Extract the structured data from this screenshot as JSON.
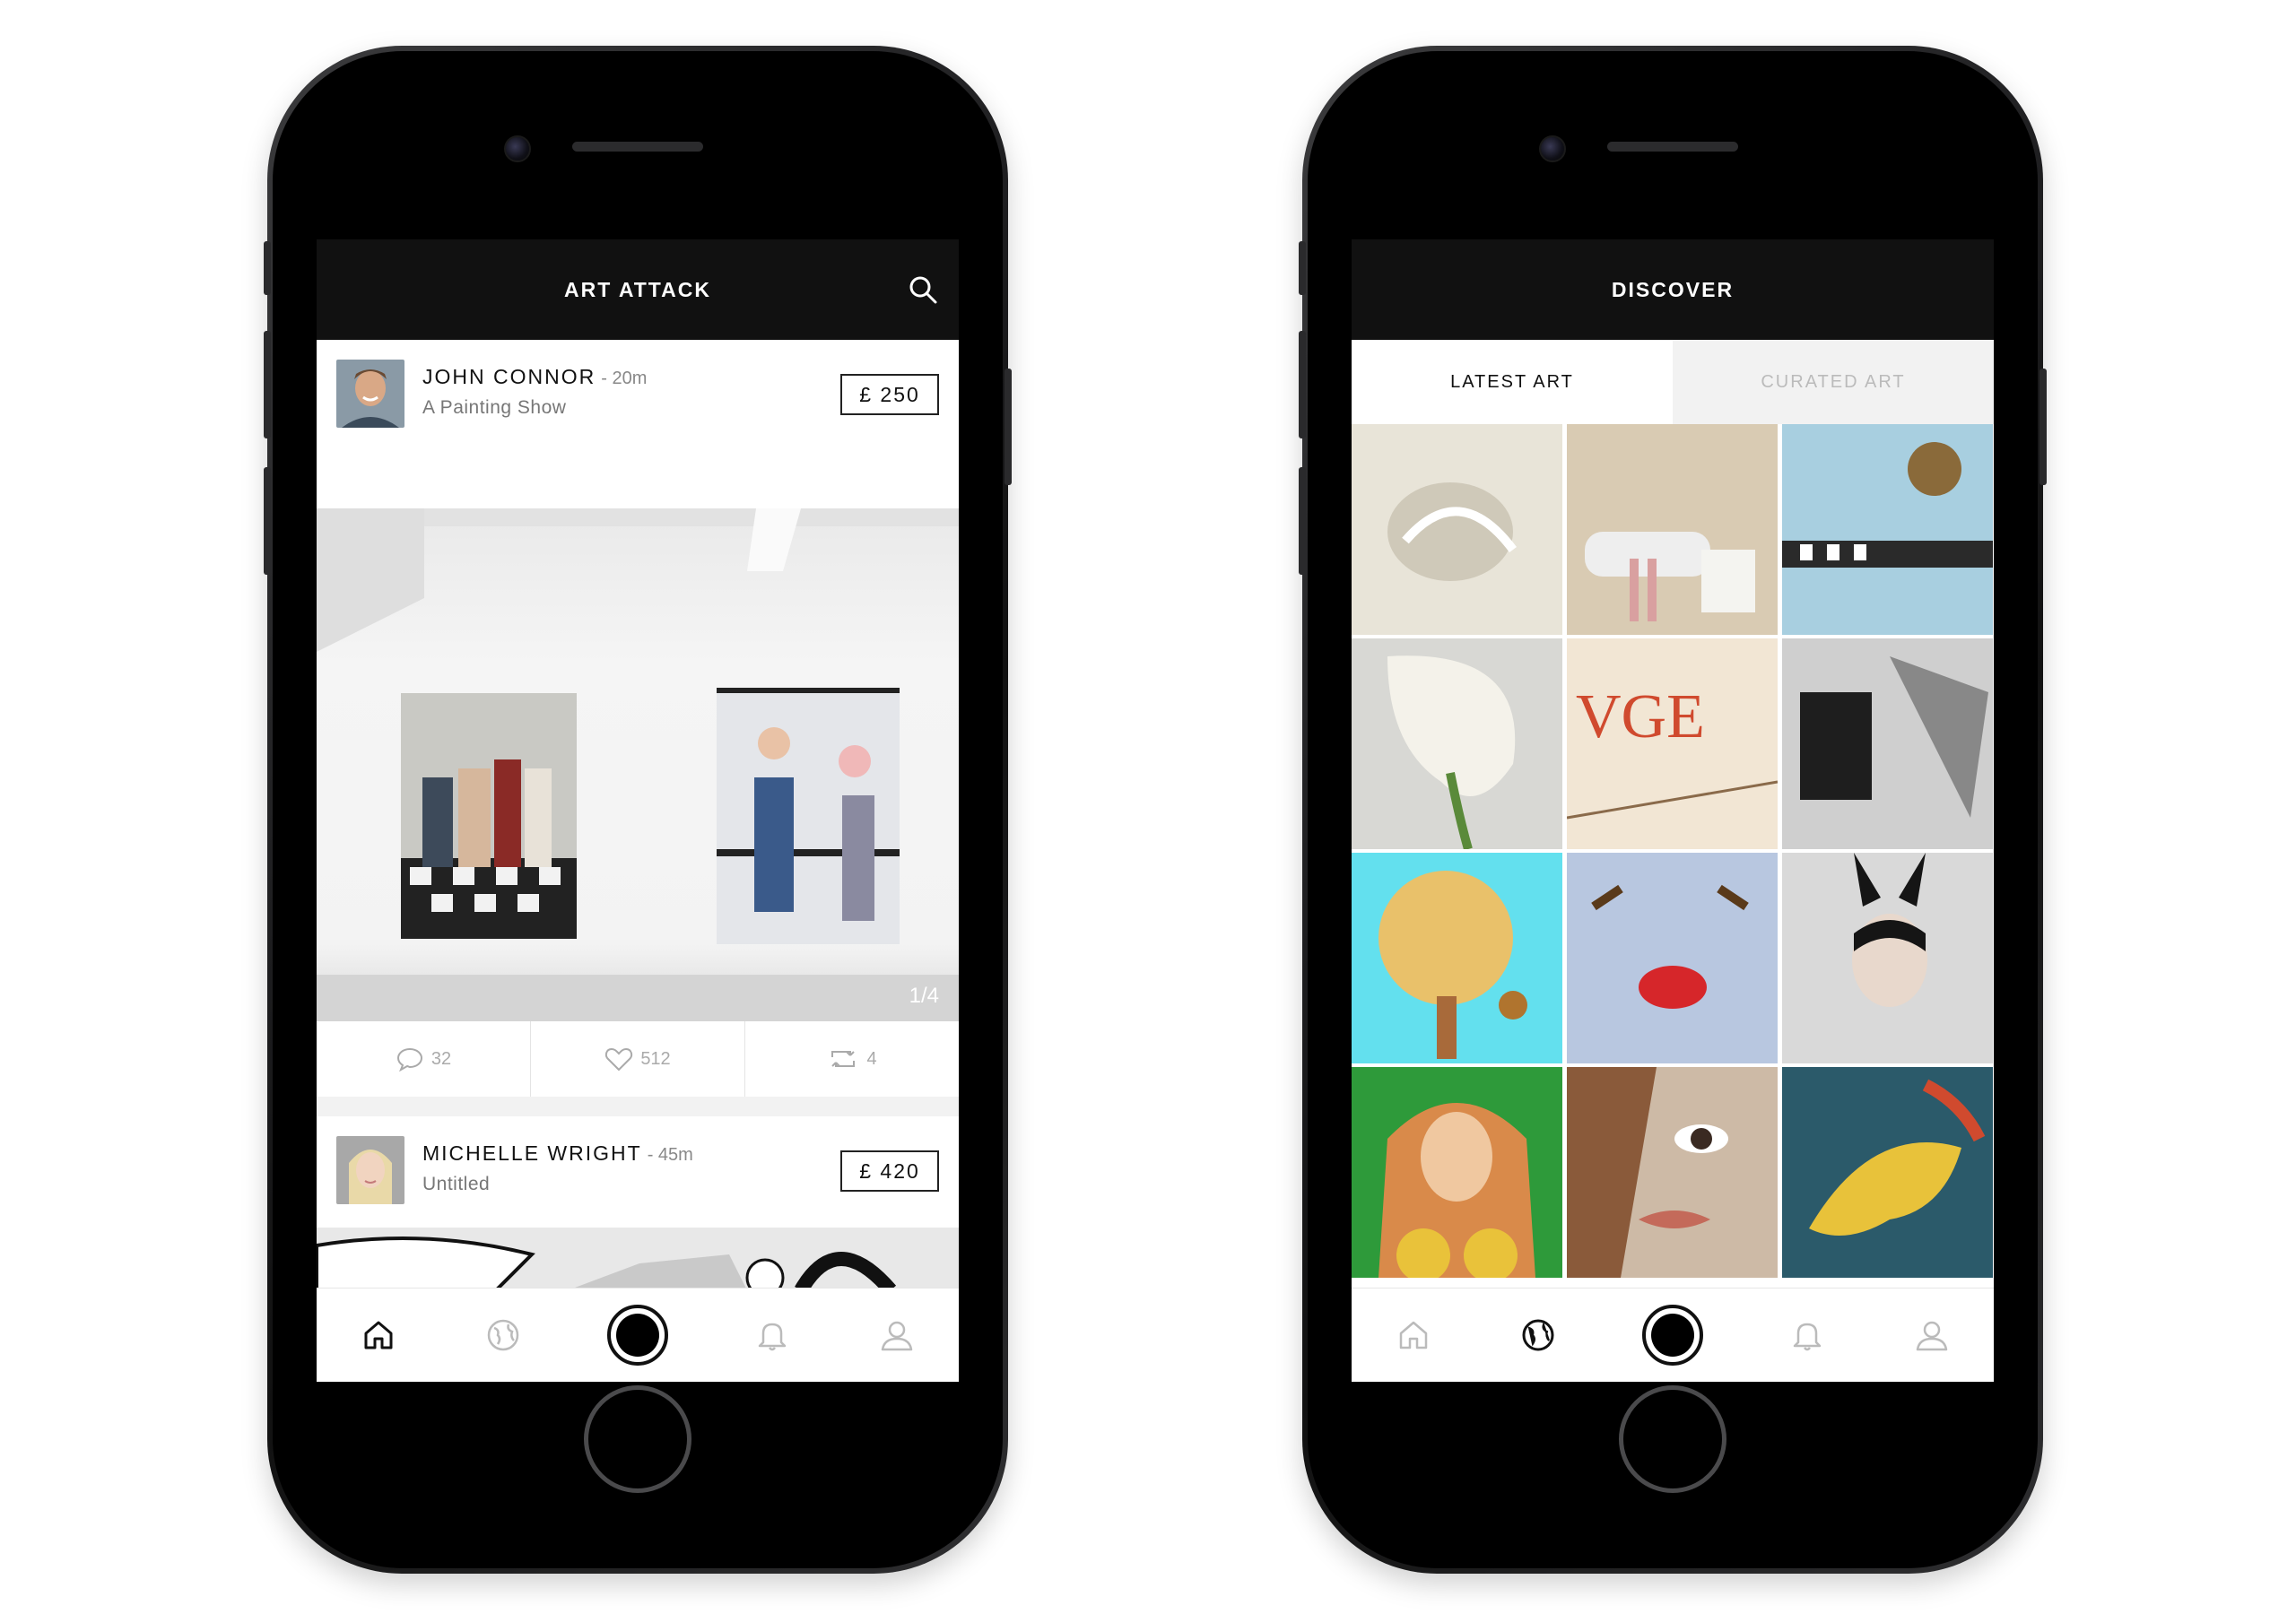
{
  "feed": {
    "title": "ART ATTACK",
    "posts": [
      {
        "user": "JOHN CONNOR",
        "time": "- 20m",
        "title": "A Painting Show",
        "price": "£ 250",
        "counter": "1/4",
        "comments": "32",
        "likes": "512",
        "reposts": "4"
      },
      {
        "user": "MICHELLE WRIGHT",
        "time": "- 45m",
        "title": "Untitled",
        "price": "£ 420"
      }
    ]
  },
  "discover": {
    "title": "DISCOVER",
    "tabs": {
      "latest": "LATEST ART",
      "curated": "CURATED ART"
    },
    "artworks": [
      {
        "name": "artwork-face-sculpture",
        "bg": "#e8e4d8",
        "accent": "#cfc9b9"
      },
      {
        "name": "artwork-bathroom",
        "bg": "#d9cbb3",
        "accent": "#a48b6a"
      },
      {
        "name": "artwork-keyboard",
        "bg": "#a8cfe0",
        "accent": "#2a2a2a"
      },
      {
        "name": "artwork-calla-lily",
        "bg": "#d8d8d4",
        "accent": "#f4f2ea"
      },
      {
        "name": "artwork-vogue",
        "bg": "#f2e6d4",
        "accent": "#d04a2e"
      },
      {
        "name": "artwork-abstract-bw",
        "bg": "#cfcfcf",
        "accent": "#1e1e1e"
      },
      {
        "name": "artwork-ping-pong",
        "bg": "#63e0ee",
        "accent": "#e9c16a"
      },
      {
        "name": "artwork-palm-lips",
        "bg": "#b8c7e0",
        "accent": "#d6262a"
      },
      {
        "name": "artwork-bunny-mask",
        "bg": "#d9d9d9",
        "accent": "#151515"
      },
      {
        "name": "artwork-pop-woman",
        "bg": "#2e9a3a",
        "accent": "#d98a4a"
      },
      {
        "name": "artwork-collage-face",
        "bg": "#cdbaa6",
        "accent": "#3a2a22"
      },
      {
        "name": "artwork-yellow-figure",
        "bg": "#2b5a6a",
        "accent": "#e8c23a"
      }
    ]
  }
}
